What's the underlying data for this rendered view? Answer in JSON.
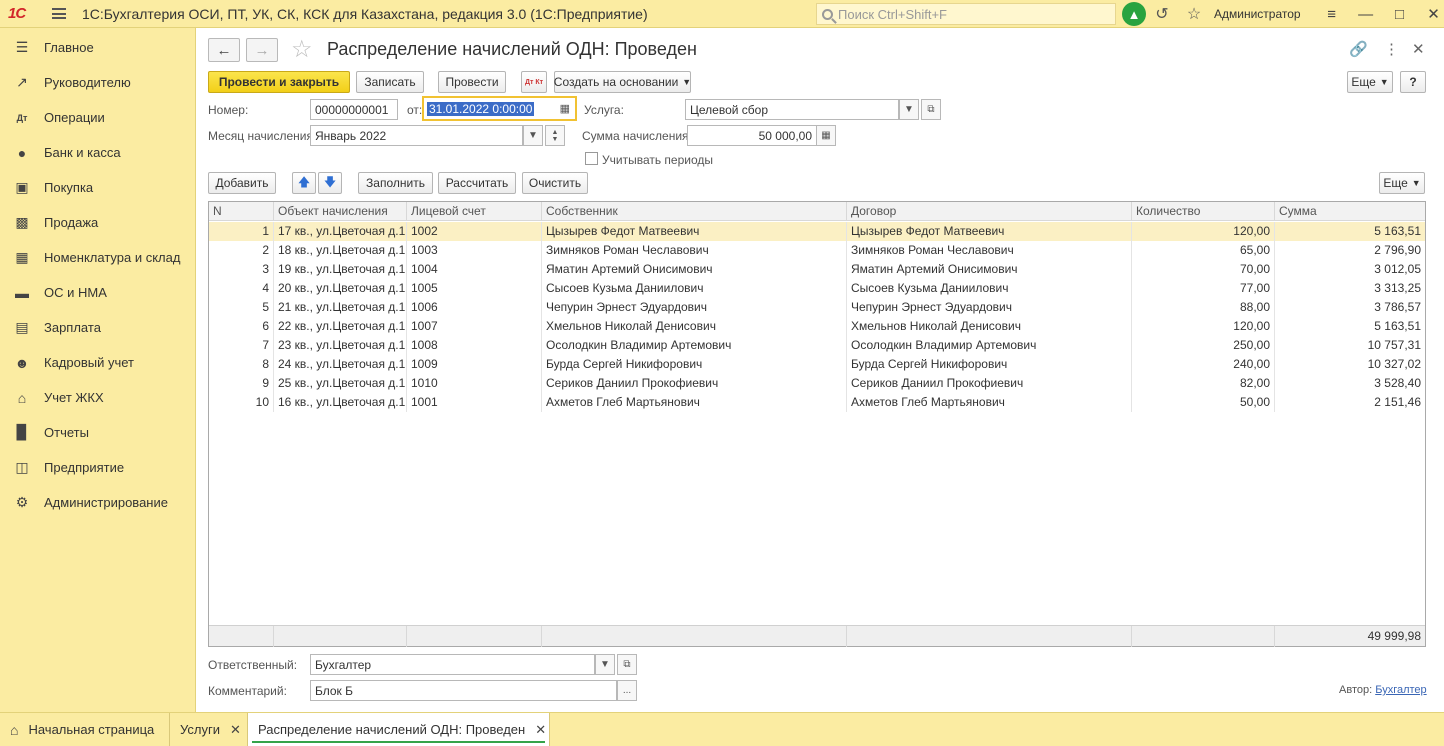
{
  "app": {
    "title": "1С:Бухгалтерия ОСИ, ПТ, УК, СК, КСК для Казахстана, редакция 3.0  (1С:Предприятие)",
    "logo": "1С",
    "search_placeholder": "Поиск Ctrl+Shift+F",
    "user": "Администратор"
  },
  "sidebar": {
    "items": [
      {
        "label": "Главное",
        "icon": "list-icon"
      },
      {
        "label": "Руководителю",
        "icon": "chart-line-icon"
      },
      {
        "label": "Операции",
        "icon": "dt-kt-icon"
      },
      {
        "label": "Банк и касса",
        "icon": "coin-icon"
      },
      {
        "label": "Покупка",
        "icon": "cart-icon"
      },
      {
        "label": "Продажа",
        "icon": "bag-icon"
      },
      {
        "label": "Номенклатура и склад",
        "icon": "grid-icon"
      },
      {
        "label": "ОС и НМА",
        "icon": "truck-icon"
      },
      {
        "label": "Зарплата",
        "icon": "money-icon"
      },
      {
        "label": "Кадровый учет",
        "icon": "people-icon"
      },
      {
        "label": "Учет ЖКХ",
        "icon": "house-icon"
      },
      {
        "label": "Отчеты",
        "icon": "bar-chart-icon"
      },
      {
        "label": "Предприятие",
        "icon": "building-icon"
      },
      {
        "label": "Администрирование",
        "icon": "gear-icon"
      }
    ]
  },
  "document": {
    "title": "Распределение начислений ОДН: Проведен"
  },
  "toolbar": {
    "post_close": "Провести и закрыть",
    "save": "Записать",
    "post": "Провести",
    "dtkt": "Дт Кт",
    "create_based": "Создать на основании",
    "more": "Еще",
    "help": "?"
  },
  "form": {
    "number_label": "Номер:",
    "number_value": "00000000001",
    "date_label": "от:",
    "date_value": "31.01.2022  0:00:00",
    "service_label": "Услуга:",
    "service_value": "Целевой сбор",
    "month_label": "Месяц начисления:",
    "month_value": "Январь 2022",
    "sum_label": "Сумма начисления:",
    "sum_value": "50 000,00",
    "periods_label": "Учитывать периоды"
  },
  "table_toolbar": {
    "add": "Добавить",
    "fill": "Заполнить",
    "calc": "Рассчитать",
    "clear": "Очистить",
    "more": "Еще"
  },
  "table": {
    "columns": [
      "N",
      "Объект начисления",
      "Лицевой счет",
      "Собственник",
      "Договор",
      "Количество",
      "Сумма"
    ],
    "rows": [
      [
        "1",
        "17 кв., ул.Цветочая д.1...",
        "1002",
        "Цызырев Федот Матвеевич",
        "Цызырев Федот Матвеевич",
        "120,00",
        "5 163,51"
      ],
      [
        "2",
        "18 кв., ул.Цветочая д.1...",
        "1003",
        "Зимняков Роман Чеславович",
        "Зимняков Роман Чеславович",
        "65,00",
        "2 796,90"
      ],
      [
        "3",
        "19 кв., ул.Цветочая д.1...",
        "1004",
        "Яматин Артемий Онисимович",
        "Яматин Артемий Онисимович",
        "70,00",
        "3 012,05"
      ],
      [
        "4",
        "20 кв., ул.Цветочая д.1...",
        "1005",
        "Сысоев Кузьма Даниилович",
        "Сысоев Кузьма Даниилович",
        "77,00",
        "3 313,25"
      ],
      [
        "5",
        "21 кв., ул.Цветочая д.1...",
        "1006",
        "Чепурин Эрнест Эдуардович",
        "Чепурин Эрнест Эдуардович",
        "88,00",
        "3 786,57"
      ],
      [
        "6",
        "22 кв., ул.Цветочая д.1...",
        "1007",
        "Хмельнов Николай Денисович",
        "Хмельнов Николай Денисович",
        "120,00",
        "5 163,51"
      ],
      [
        "7",
        "23 кв., ул.Цветочая д.1...",
        "1008",
        "Осолодкин Владимир Артемович",
        "Осолодкин Владимир Артемович",
        "250,00",
        "10 757,31"
      ],
      [
        "8",
        "24 кв., ул.Цветочая д.1...",
        "1009",
        "Бурда Сергей Никифорович",
        "Бурда Сергей Никифорович",
        "240,00",
        "10 327,02"
      ],
      [
        "9",
        "25 кв., ул.Цветочая д.1...",
        "1010",
        "Сериков Даниил Прокофиевич",
        "Сериков Даниил Прокофиевич",
        "82,00",
        "3 528,40"
      ],
      [
        "10",
        "16 кв., ул.Цветочая д.1...",
        "1001",
        "Ахметов Глеб Мартьянович",
        "Ахметов Глеб Мартьянович",
        "50,00",
        "2 151,46"
      ]
    ],
    "total": "49 999,98"
  },
  "bottom": {
    "responsible_label": "Ответственный:",
    "responsible_value": "Бухгалтер",
    "comment_label": "Комментарий:",
    "comment_value": "Блок Б",
    "author_label": "Автор:",
    "author_value": "Бухгалтер"
  },
  "tabs": [
    {
      "label": "Начальная страница"
    },
    {
      "label": "Услуги"
    },
    {
      "label": "Распределение начислений ОДН: Проведен"
    }
  ],
  "colors": {
    "panel": "#fbeca2",
    "primary_button": "#f2cf18",
    "selected_row": "#fbf0c4",
    "bell": "#29a33f",
    "active_tab_underline": "#35a34a"
  }
}
